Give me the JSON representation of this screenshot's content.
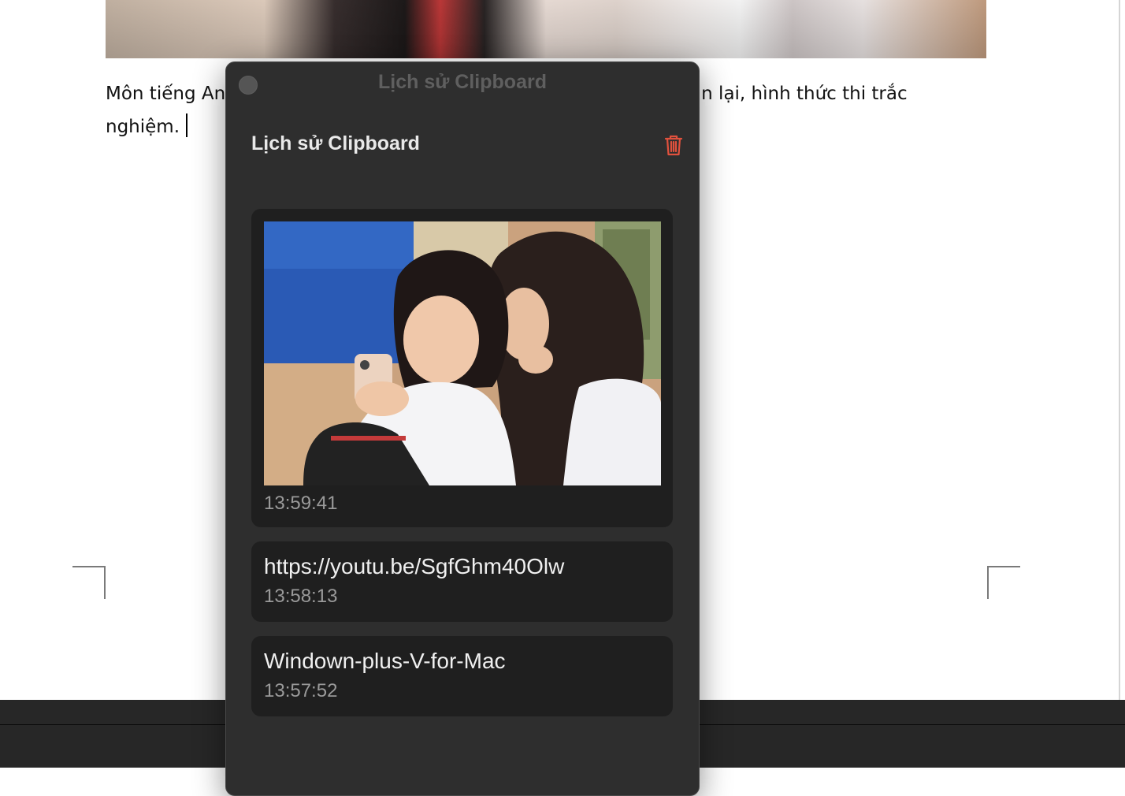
{
  "document": {
    "text_line1_left": "Môn tiếng An",
    "text_line1_right": "n lại, hình thức thi trắc",
    "text_line2": "nghiệm."
  },
  "clipboard_window": {
    "window_title": "Lịch sử Clipboard",
    "panel_title": "Lịch sử Clipboard",
    "icons": {
      "close": "close-dot-icon",
      "trash": "trash-icon"
    },
    "colors": {
      "trash": "#e0513d",
      "window_bg": "#2e2e2e",
      "card_bg": "#1f1f1f"
    },
    "items": [
      {
        "type": "image",
        "image_description_icon": "photo-thumbnail",
        "time": "13:59:41"
      },
      {
        "type": "text",
        "content": "https://youtu.be/SgfGhm40Olw",
        "time": "13:58:13"
      },
      {
        "type": "text",
        "content": "Windown-plus-V-for-Mac",
        "time": "13:57:52"
      }
    ]
  }
}
